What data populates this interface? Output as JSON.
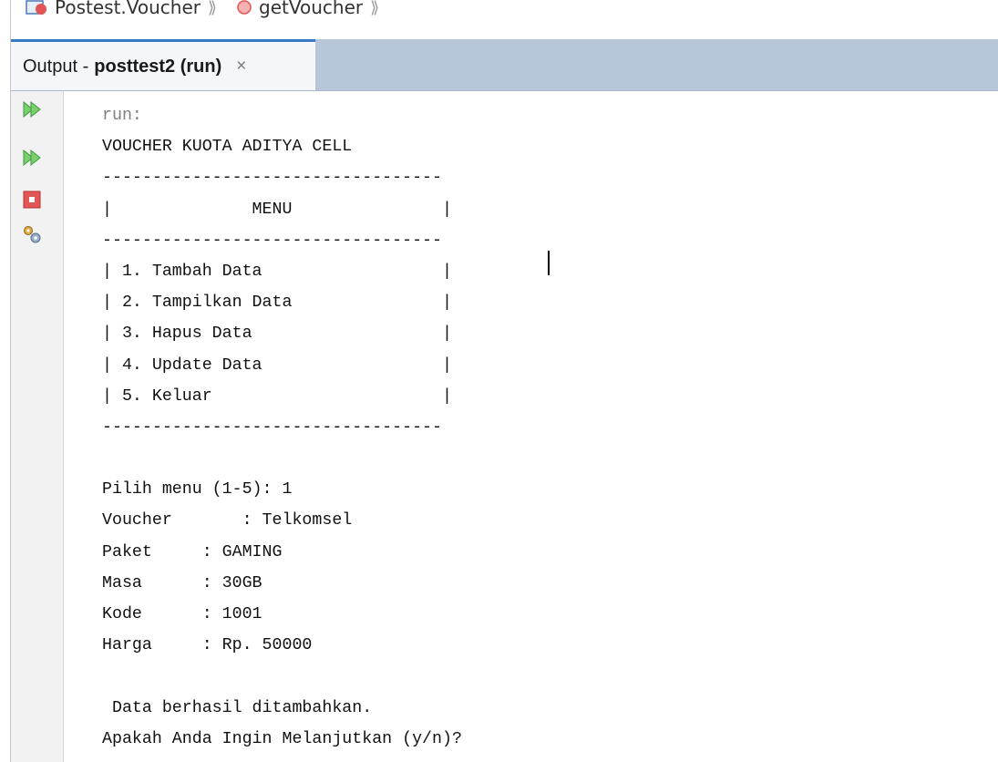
{
  "breadcrumb": {
    "class_label": "Postest.Voucher",
    "method_label": "getVoucher",
    "separator": "⟫"
  },
  "output_tab": {
    "prefix": "Output - ",
    "title": "posttest2 (run)",
    "close": "×"
  },
  "toolbar": {
    "icons": [
      "rerun-icon",
      "rerun-with-options-icon",
      "stop-icon",
      "settings-icon"
    ]
  },
  "console": {
    "lines": [
      "run:",
      "VOUCHER KUOTA ADITYA CELL",
      "----------------------------------",
      "|              MENU               |",
      "----------------------------------",
      "| 1. Tambah Data                  |",
      "| 2. Tampilkan Data               |",
      "| 3. Hapus Data                   |",
      "| 4. Update Data                  |",
      "| 5. Keluar                       |",
      "----------------------------------",
      "",
      "Pilih menu (1-5): 1",
      "Voucher       : Telkomsel",
      "Paket     : GAMING",
      "Masa      : 30GB",
      "Kode      : 1001",
      "Harga     : Rp. 50000",
      "",
      " Data berhasil ditambahkan.",
      "Apakah Anda Ingin Melanjutkan (y/n)?"
    ]
  },
  "colors": {
    "tab_accent": "#3b7ac3",
    "tabbar_bg": "#b7c7d9",
    "run_label": "#808080",
    "rerun_green": "#5cb85c",
    "stop_red": "#e25555"
  }
}
